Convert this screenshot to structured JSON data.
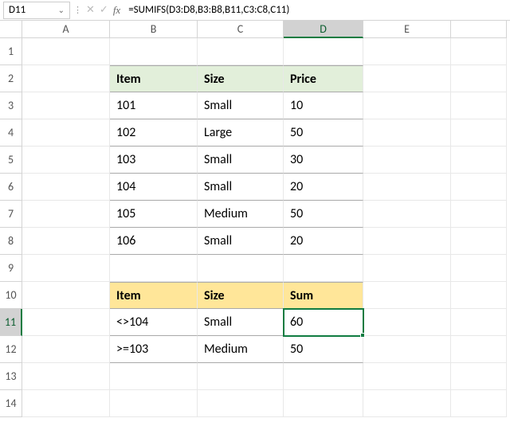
{
  "nameBox": {
    "ref": "D11"
  },
  "formulaBar": {
    "value": "=SUMIFS(D3:D8,B3:B8,B11,C3:C8,C11)"
  },
  "columns": [
    "A",
    "B",
    "C",
    "D",
    "E"
  ],
  "activeCol": "D",
  "activeRow": "11",
  "table1": {
    "headers": [
      "Item",
      "Size",
      "Price"
    ],
    "rows": [
      [
        "101",
        "Small",
        "10"
      ],
      [
        "102",
        "Large",
        "50"
      ],
      [
        "103",
        "Small",
        "30"
      ],
      [
        "104",
        "Small",
        "20"
      ],
      [
        "105",
        "Medium",
        "50"
      ],
      [
        "106",
        "Small",
        "20"
      ]
    ]
  },
  "table2": {
    "headers": [
      "Item",
      "Size",
      "Sum"
    ],
    "rows": [
      [
        "<>104",
        "Small",
        "60"
      ],
      [
        ">=103",
        "Medium",
        "50"
      ]
    ]
  }
}
